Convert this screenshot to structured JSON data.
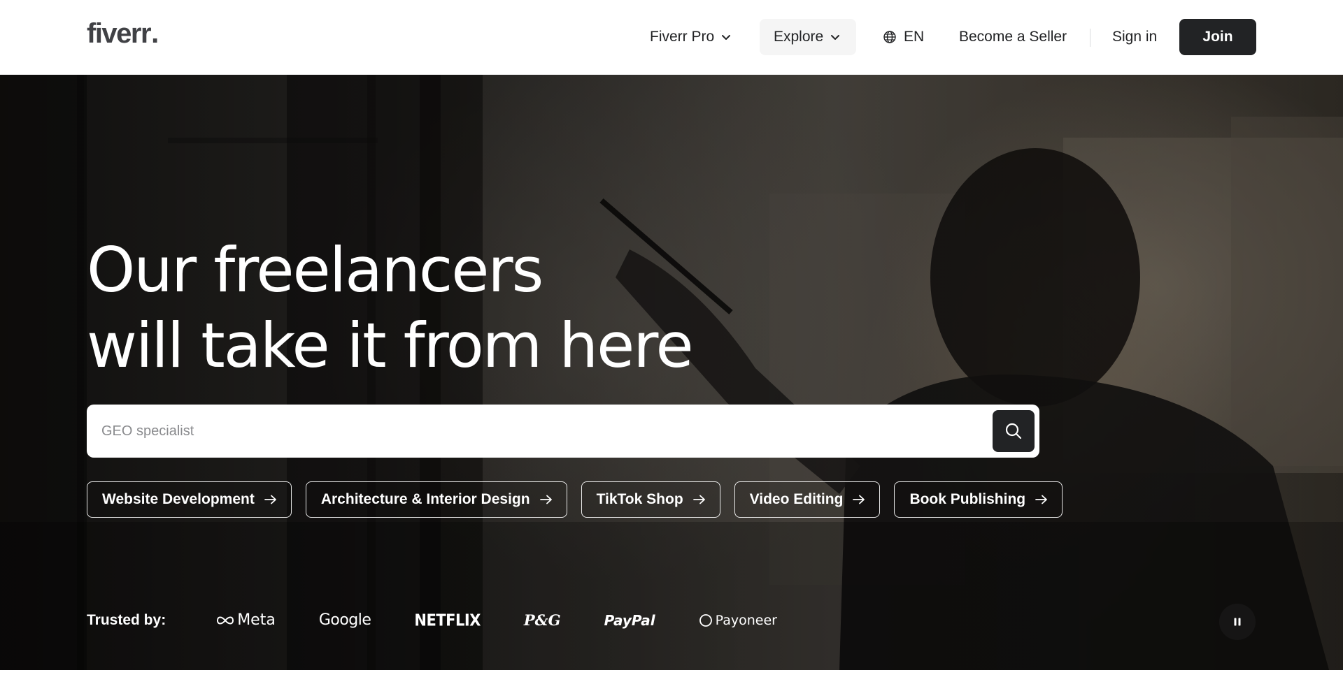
{
  "header": {
    "logo": {
      "text": "fiverr",
      "dot": "."
    },
    "nav": {
      "fiverr_pro": "Fiverr Pro",
      "explore": "Explore",
      "language": "EN",
      "become_seller": "Become a Seller",
      "sign_in": "Sign in",
      "join": "Join"
    },
    "icons": {
      "fiverr_pro_chevron": "chevron-down-icon",
      "explore_chevron": "chevron-down-icon",
      "language_icon": "globe-icon"
    }
  },
  "hero": {
    "headline_line1": "Our freelancers",
    "headline_line2": "will take it from here",
    "search": {
      "placeholder": "GEO specialist",
      "value": "",
      "button_icon": "search-icon"
    },
    "categories": [
      {
        "label": "Website Development",
        "icon": "arrow-right-icon"
      },
      {
        "label": "Architecture & Interior Design",
        "icon": "arrow-right-icon"
      },
      {
        "label": "TikTok Shop",
        "icon": "arrow-right-icon"
      },
      {
        "label": "Video Editing",
        "icon": "arrow-right-icon"
      },
      {
        "label": "Book Publishing",
        "icon": "arrow-right-icon"
      }
    ],
    "trusted_by": {
      "label": "Trusted by:",
      "brands": [
        "Meta",
        "Google",
        "NETFLIX",
        "P&G",
        "PayPal",
        "Payoneer"
      ]
    },
    "video_control": {
      "icon": "pause-icon",
      "state": "playing"
    }
  },
  "colors": {
    "text_dark": "#222325",
    "join_bg": "#222325",
    "explore_bg": "#f5f5f5",
    "logo": "#404145",
    "white": "#ffffff"
  }
}
